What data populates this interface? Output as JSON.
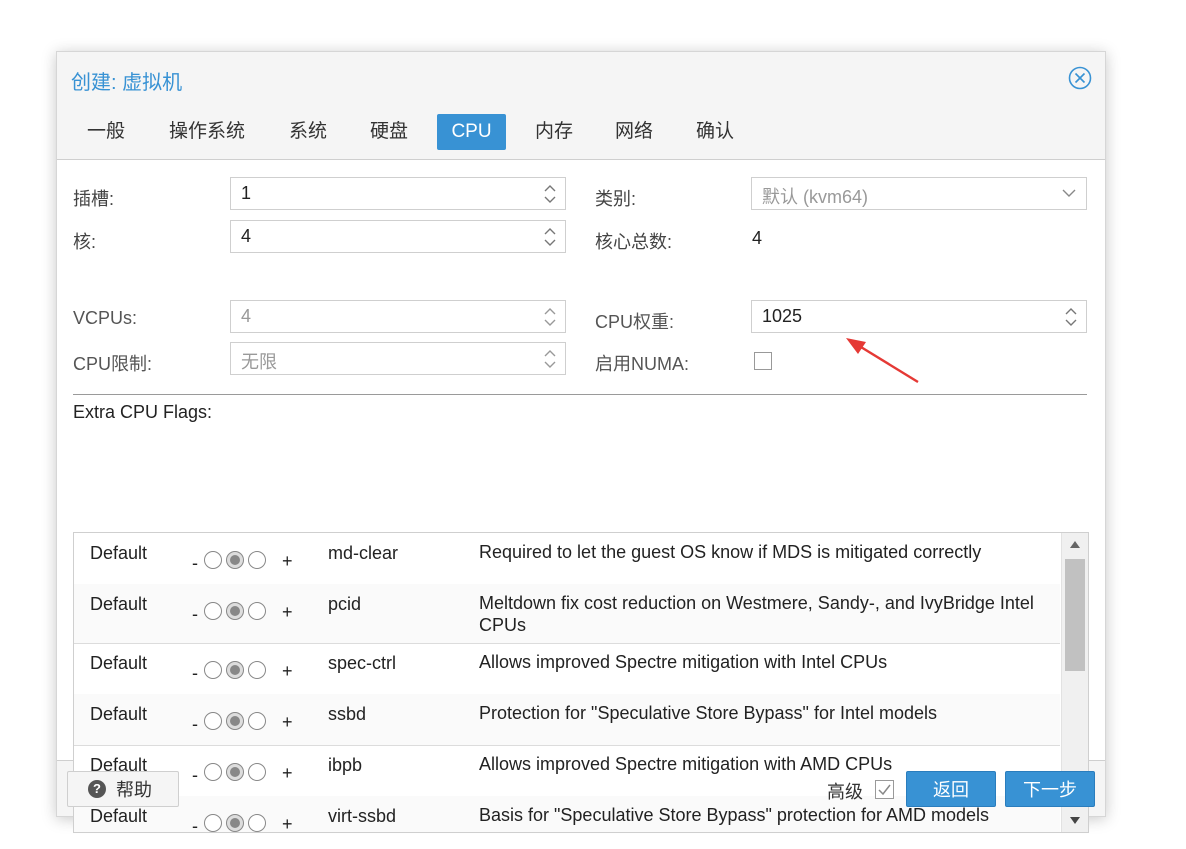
{
  "dialog": {
    "title": "创建: 虚拟机"
  },
  "tabs": [
    {
      "label": "一般"
    },
    {
      "label": "操作系统"
    },
    {
      "label": "系统"
    },
    {
      "label": "硬盘"
    },
    {
      "label": "CPU",
      "active": true
    },
    {
      "label": "内存"
    },
    {
      "label": "网络"
    },
    {
      "label": "确认"
    }
  ],
  "form": {
    "sockets": {
      "label": "插槽:",
      "value": "1"
    },
    "cores": {
      "label": "核:",
      "value": "4"
    },
    "type": {
      "label": "类别:",
      "value": "默认 (kvm64)"
    },
    "total_cores": {
      "label": "核心总数:",
      "value": "4"
    },
    "vcpus": {
      "label": "VCPUs:",
      "value": "4"
    },
    "cpu_limit": {
      "label": "CPU限制:",
      "placeholder": "无限"
    },
    "cpu_units": {
      "label": "CPU权重:",
      "value": "1025"
    },
    "numa": {
      "label": "启用NUMA:"
    }
  },
  "flags": {
    "title": "Extra CPU Flags:",
    "minus": "-",
    "plus": "+",
    "rows": [
      {
        "state": "Default",
        "name": "md-clear",
        "desc": "Required to let the guest OS know if MDS is mitigated correctly"
      },
      {
        "state": "Default",
        "name": "pcid",
        "desc": "Meltdown fix cost reduction on Westmere, Sandy-, and IvyBridge Intel CPUs"
      },
      {
        "state": "Default",
        "name": "spec-ctrl",
        "desc": "Allows improved Spectre mitigation with Intel CPUs"
      },
      {
        "state": "Default",
        "name": "ssbd",
        "desc": "Protection for \"Speculative Store Bypass\" for Intel models"
      },
      {
        "state": "Default",
        "name": "ibpb",
        "desc": "Allows improved Spectre mitigation with AMD CPUs"
      },
      {
        "state": "Default",
        "name": "virt-ssbd",
        "desc": "Basis for \"Speculative Store Bypass\" protection for AMD models"
      }
    ]
  },
  "footer": {
    "help_icon": "?",
    "help_label": "帮助",
    "advanced_label": "高级",
    "back_label": "返回",
    "next_label": "下一步"
  },
  "colors": {
    "accent": "#3892d4",
    "annotation_arrow": "#e53935"
  }
}
